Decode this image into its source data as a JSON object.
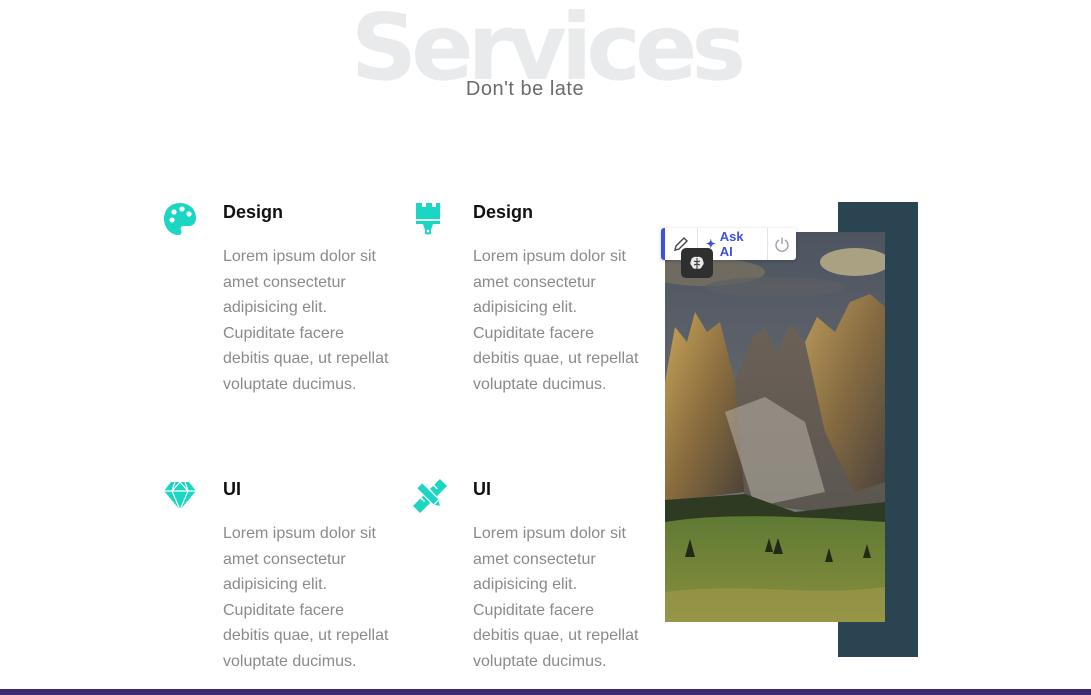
{
  "header": {
    "background_title": "Services",
    "subtitle": "Don't be late"
  },
  "services": [
    {
      "icon": "palette-icon",
      "title": "Design",
      "text": "Lorem ipsum dolor sit amet consectetur adipisicing elit. Cupiditate facere debitis quae, ut repellat voluptate ducimus."
    },
    {
      "icon": "paint-brush-icon",
      "title": "Design",
      "text": "Lorem ipsum dolor sit amet consectetur adipisicing elit. Cupiditate facere debitis quae, ut repellat voluptate ducimus."
    },
    {
      "icon": "diamond-icon",
      "title": "UI",
      "text": "Lorem ipsum dolor sit amet consectetur adipisicing elit. Cupiditate facere debitis quae, ut repellat voluptate ducimus."
    },
    {
      "icon": "pencil-ruler-icon",
      "title": "UI",
      "text": "Lorem ipsum dolor sit amet consectetur adipisicing elit. Cupiditate facere debitis quae, ut repellat voluptate ducimus."
    }
  ],
  "ai_toolbar": {
    "ask_ai_label": "Ask AI",
    "icons": [
      "pencil-icon",
      "sparkle-icon",
      "power-icon",
      "brain-icon"
    ]
  },
  "colors": {
    "accent": "#1cd6c4",
    "dark_block": "#2b4451",
    "toolbar_accent": "#3f51e0",
    "bottom_bar": "#3b2a73"
  }
}
